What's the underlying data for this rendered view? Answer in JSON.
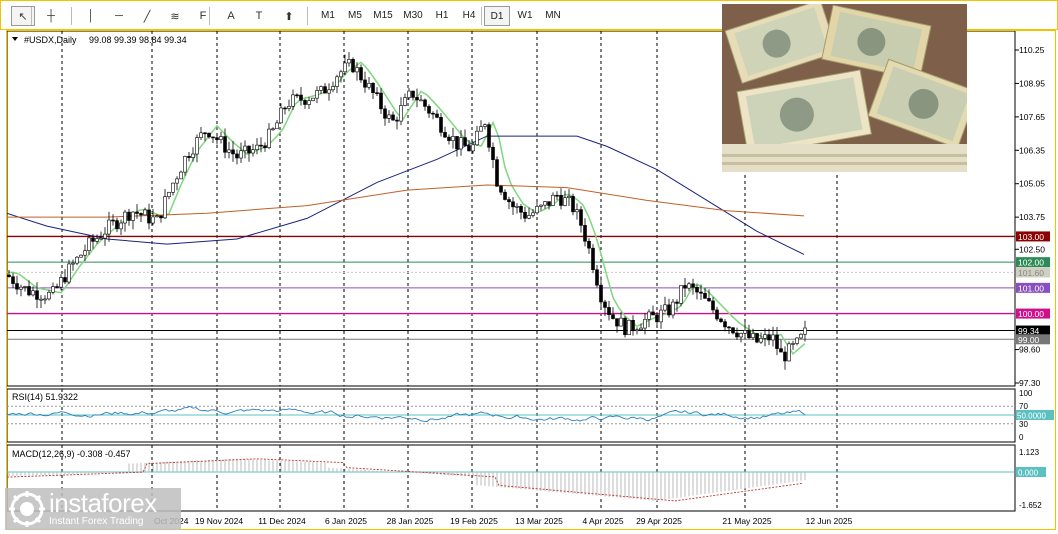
{
  "toolbar": {
    "tools": [
      {
        "name": "cursor-icon",
        "glyph": "↖"
      },
      {
        "name": "crosshair-icon",
        "glyph": "┼"
      },
      {
        "name": "vertical-line-icon",
        "glyph": "│"
      },
      {
        "name": "horizontal-line-icon",
        "glyph": "─"
      },
      {
        "name": "trendline-icon",
        "glyph": "╱"
      },
      {
        "name": "channel-icon",
        "glyph": "≋"
      },
      {
        "name": "fibonacci-icon",
        "glyph": "F"
      },
      {
        "name": "text-icon",
        "glyph": "A"
      },
      {
        "name": "text-label-icon",
        "glyph": "T"
      },
      {
        "name": "arrows-icon",
        "glyph": "⬆"
      }
    ],
    "timeframes": [
      "M1",
      "M5",
      "M15",
      "M30",
      "H1",
      "H4",
      "D1",
      "W1",
      "MN"
    ],
    "active_timeframe": "D1"
  },
  "chart": {
    "header_symbol": "#USDX,Daily",
    "header_values": "99.08 99.39 98.84 99.34",
    "price_ticks": [
      "110.25",
      "108.95",
      "107.65",
      "106.35",
      "105.05",
      "103.75",
      "102.50",
      "97.30",
      "98.60"
    ],
    "levels": [
      {
        "label": "103.00",
        "color": "#8b0000"
      },
      {
        "label": "102.00",
        "color": "#2e8b57"
      },
      {
        "label": "101.60",
        "color": "#d0d0c0"
      },
      {
        "label": "101.00",
        "color": "#8a4fbf"
      },
      {
        "label": "100.00",
        "color": "#d0108a"
      },
      {
        "label": "99.34",
        "color": "#000000"
      },
      {
        "label": "99.00",
        "color": "#777777"
      }
    ],
    "dates": [
      "Oct 2024",
      "19 Nov 2024",
      "11 Dec 2024",
      "6 Jan 2025",
      "28 Jan 2025",
      "19 Feb 2025",
      "13 Mar 2025",
      "4 Apr 2025",
      "29 Apr 2025",
      "21 May 2025",
      "12 Jun 2025"
    ]
  },
  "rsi": {
    "label": "RSI(14) 51.9322",
    "ticks": [
      "100",
      "70",
      "50",
      "30",
      "0"
    ],
    "level_label": "50.0000"
  },
  "macd": {
    "label": "MACD(12,26,9) -0.308 -0.457",
    "ticks": [
      "1.123",
      "-1.652"
    ],
    "zero_label": "0.000"
  },
  "watermark": {
    "brand": "instaforex",
    "tagline": "Instant Forex Trading"
  },
  "colors": {
    "accent_border": "#f0c400",
    "ma_fast": "#7fd77f",
    "ma_mid": "#1a237e",
    "ma_slow": "#c0602a",
    "rsi_line": "#2a7fbf",
    "macd_signal": "#c0392b"
  }
}
